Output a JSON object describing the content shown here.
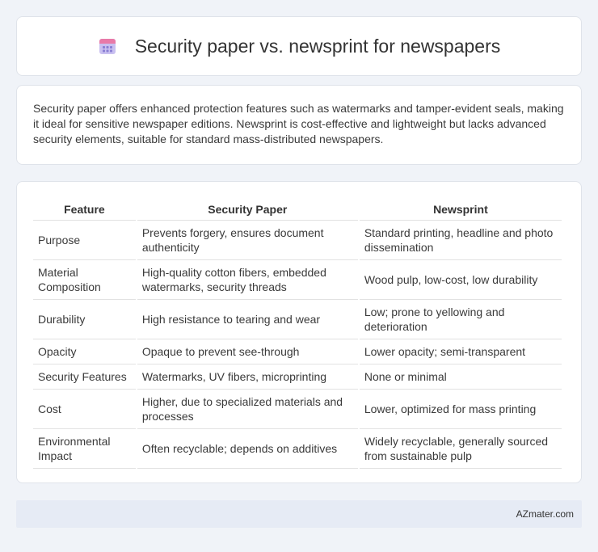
{
  "header": {
    "title": "Security paper vs. newsprint for newspapers",
    "icon": "calendar-icon",
    "icon_colors": {
      "top": "#e87aa8",
      "body": "#b9aee8",
      "dots": "#7f73c9"
    }
  },
  "intro": {
    "text": "Security paper offers enhanced protection features such as watermarks and tamper-evident seals, making it ideal for sensitive newspaper editions. Newsprint is cost-effective and lightweight but lacks advanced security elements, suitable for standard mass-distributed newspapers."
  },
  "table": {
    "headers": [
      "Feature",
      "Security Paper",
      "Newsprint"
    ],
    "rows": [
      [
        "Purpose",
        "Prevents forgery, ensures document authenticity",
        "Standard printing, headline and photo dissemination"
      ],
      [
        "Material Composition",
        "High-quality cotton fibers, embedded watermarks, security threads",
        "Wood pulp, low-cost, low durability"
      ],
      [
        "Durability",
        "High resistance to tearing and wear",
        "Low; prone to yellowing and deterioration"
      ],
      [
        "Opacity",
        "Opaque to prevent see-through",
        "Lower opacity; semi-transparent"
      ],
      [
        "Security Features",
        "Watermarks, UV fibers, microprinting",
        "None or minimal"
      ],
      [
        "Cost",
        "Higher, due to specialized materials and processes",
        "Lower, optimized for mass printing"
      ],
      [
        "Environmental Impact",
        "Often recyclable; depends on additives",
        "Widely recyclable, generally sourced from sustainable pulp"
      ]
    ]
  },
  "footer": {
    "text": "AZmater.com"
  }
}
